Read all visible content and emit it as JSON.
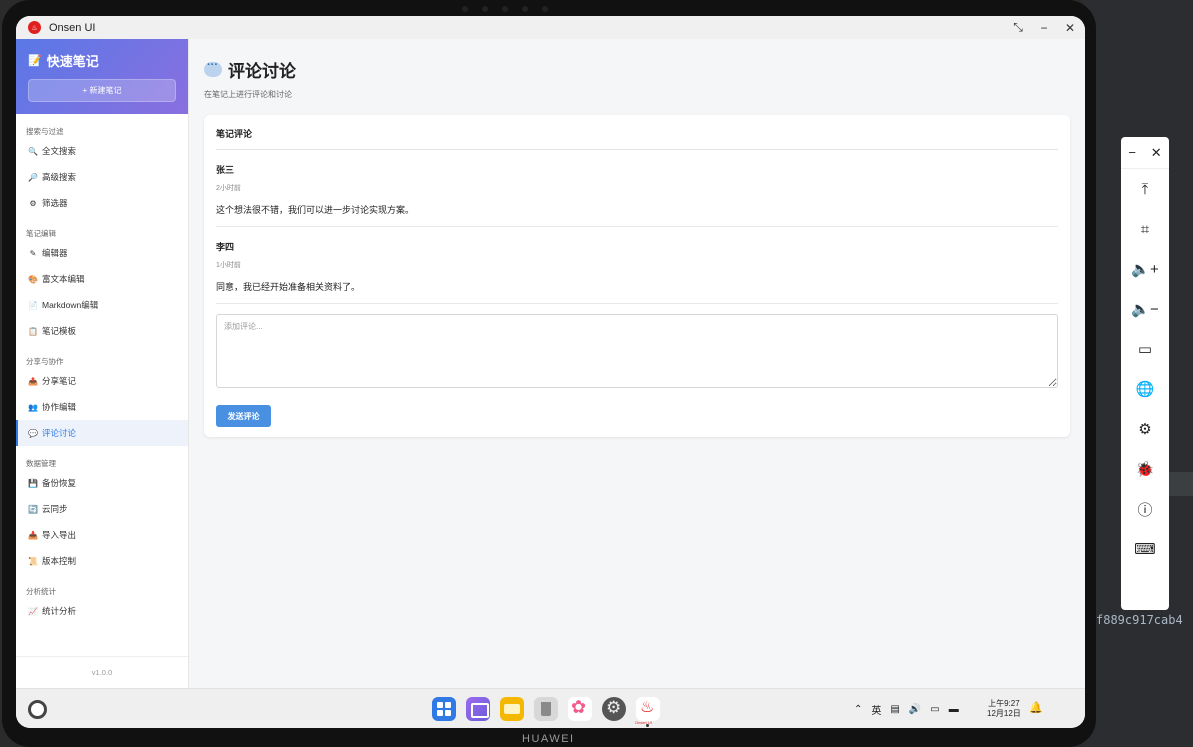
{
  "window": {
    "title": "Onsen UI"
  },
  "sidebar": {
    "title": "快速笔记",
    "new_note_button": "+ 新建笔记",
    "sections": [
      {
        "label": "搜索与过滤",
        "items": [
          {
            "label": "全文搜索",
            "icon": "search-icon"
          },
          {
            "label": "高级搜索",
            "icon": "magnifier-icon"
          },
          {
            "label": "筛选器",
            "icon": "filter-icon"
          }
        ]
      },
      {
        "label": "笔记编辑",
        "items": [
          {
            "label": "编辑器",
            "icon": "brush-icon"
          },
          {
            "label": "富文本编辑",
            "icon": "palette-icon"
          },
          {
            "label": "Markdown编辑",
            "icon": "document-icon"
          },
          {
            "label": "笔记模板",
            "icon": "clipboard-icon"
          }
        ]
      },
      {
        "label": "分享与协作",
        "items": [
          {
            "label": "分享笔记",
            "icon": "outbox-icon"
          },
          {
            "label": "协作编辑",
            "icon": "people-icon"
          },
          {
            "label": "评论讨论",
            "icon": "speech-bubble-icon",
            "active": true
          }
        ]
      },
      {
        "label": "数据管理",
        "items": [
          {
            "label": "备份恢复",
            "icon": "floppy-icon"
          },
          {
            "label": "云同步",
            "icon": "sync-icon"
          },
          {
            "label": "导入导出",
            "icon": "inbox-icon"
          },
          {
            "label": "版本控制",
            "icon": "scroll-icon"
          }
        ]
      },
      {
        "label": "分析统计",
        "items": [
          {
            "label": "统计分析",
            "icon": "chart-icon"
          }
        ]
      }
    ],
    "version": "v1.0.0"
  },
  "main": {
    "title": "评论讨论",
    "subtitle": "在笔记上进行评论和讨论",
    "card": {
      "title": "笔记评论",
      "comments": [
        {
          "author": "张三",
          "time": "2小时前",
          "text": "这个想法很不错，我们可以进一步讨论实现方案。"
        },
        {
          "author": "李四",
          "time": "1小时前",
          "text": "同意，我已经开始准备相关资料了。"
        }
      ],
      "input_placeholder": "添加评论...",
      "input_value": "",
      "send_button": "发送评论"
    }
  },
  "taskbar": {
    "clock_time": "上午9:27",
    "clock_date": "12月12日",
    "onsen_label": "Onsen UI"
  },
  "device": {
    "brand": "HUAWEI"
  },
  "background": {
    "hash_text": "f889c917cab4"
  },
  "colors": {
    "accent": "#2f7ae5",
    "header_gradient_start": "#5a78e6",
    "header_gradient_end": "#8a6fe0",
    "send_button": "#4a90e2"
  }
}
